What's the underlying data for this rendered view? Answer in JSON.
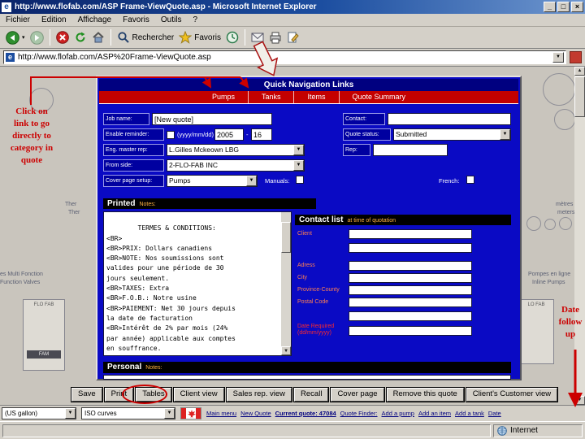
{
  "icons": {
    "ie_logo": "e",
    "minimize": "_",
    "maximize": "□",
    "close": "×",
    "dropdown_arrow": "▼",
    "scroll_up": "▲",
    "scroll_down": "▼",
    "back_more": "▾"
  },
  "browser": {
    "title_bar": {
      "title": "http://www.flofab.com/ASP Frame-ViewQuote.asp - Microsoft Internet Explorer"
    },
    "menu_bar": {
      "items": [
        "Fichier",
        "Edition",
        "Affichage",
        "Favoris",
        "Outils",
        "?"
      ]
    },
    "toolbar": {
      "search_label": "Rechercher",
      "favorites_label": "Favoris"
    },
    "address_bar": {
      "url": "http://www.flofab.com/ASP%20Frame-ViewQuote.asp"
    },
    "status_bar": {
      "zone": "Internet"
    }
  },
  "annotations": {
    "left_note": "Click on\nlink to go\ndirectly to\ncategory in\nquote",
    "right_note": "Date\nfollow\nup"
  },
  "quote_form": {
    "nav": {
      "title": "Quick Navigation Links",
      "tabs": [
        "Pumps",
        "Tanks",
        "Items",
        "Quote Summary"
      ]
    },
    "fields": {
      "job_name": {
        "label": "Job name:",
        "value": "[New quote]"
      },
      "contact": {
        "label": "Contact:",
        "value": ""
      },
      "enable_reminder": {
        "label": "Enable reminder:",
        "hint": "(yyyy/mm/dd)",
        "year": "2005",
        "sep": "-",
        "day": "16"
      },
      "quote_status": {
        "label": "Quote status:",
        "value": "Submitted"
      },
      "eng_master_rep": {
        "label": "Eng. master rep:",
        "value": "L.Gilles Mckeown LBG"
      },
      "rep": {
        "label": "Rep:",
        "value": ""
      },
      "from_side": {
        "label": "From side:",
        "value": "2-FLO-FAB INC"
      },
      "cover_page": {
        "label": "Cover page setup:",
        "value": "Pumps"
      },
      "manuals_label": "Manuals:",
      "french_label": "French:"
    },
    "printed_notes": {
      "title": "Printed",
      "subtitle": "Notes:",
      "text": "TERMES & CONDITIONS:\n<BR>\n<BR>PRIX: Dollars canadiens\n<BR>NOTE: Nos soumissions sont\nvalides pour une période de 30\njours seulement.\n<BR>TAXES: Extra\n<BR>F.O.B.: Notre usine\n<BR>PAIEMENT: Net 30 jours depuis\nla date de facturation\n<BR>Intérêt de 2% par mois (24%\npar année) applicable aux comptes\nen souffrance.\n<BR>"
    },
    "contact_list": {
      "title": "Contact list",
      "subtitle": "at time of quotation",
      "labels": [
        "Client",
        "Adress",
        "City",
        "Province-County",
        "Postal Code",
        "Date Required\n(dd/mm/yyyy)"
      ]
    },
    "personal_notes": {
      "title": "Personal",
      "subtitle": "Notes:"
    },
    "buttons": [
      "Save",
      "Print",
      "Tables",
      "Client view",
      "Sales rep. view",
      "Recall",
      "Cover page",
      "Remove this quote",
      "Client's Customer view"
    ]
  },
  "bottom_bar": {
    "unit_select": "(US gallon)",
    "curves_select": "ISO curves",
    "links": [
      "Main menu",
      "New Quote",
      "Current quote: 47084",
      "Quote Finder:",
      "Add a pump",
      "Add an item",
      "Add a tank",
      "Date"
    ]
  },
  "background": {
    "left_fragments": [
      "Ther",
      "Ther",
      "es Multi Fonction",
      "Function Valves",
      "FLO FAB",
      "FAM"
    ],
    "right_fragments": [
      "mètres",
      "meters",
      "Pompes en ligne",
      "Inline Pumps",
      "LO FAB"
    ]
  }
}
